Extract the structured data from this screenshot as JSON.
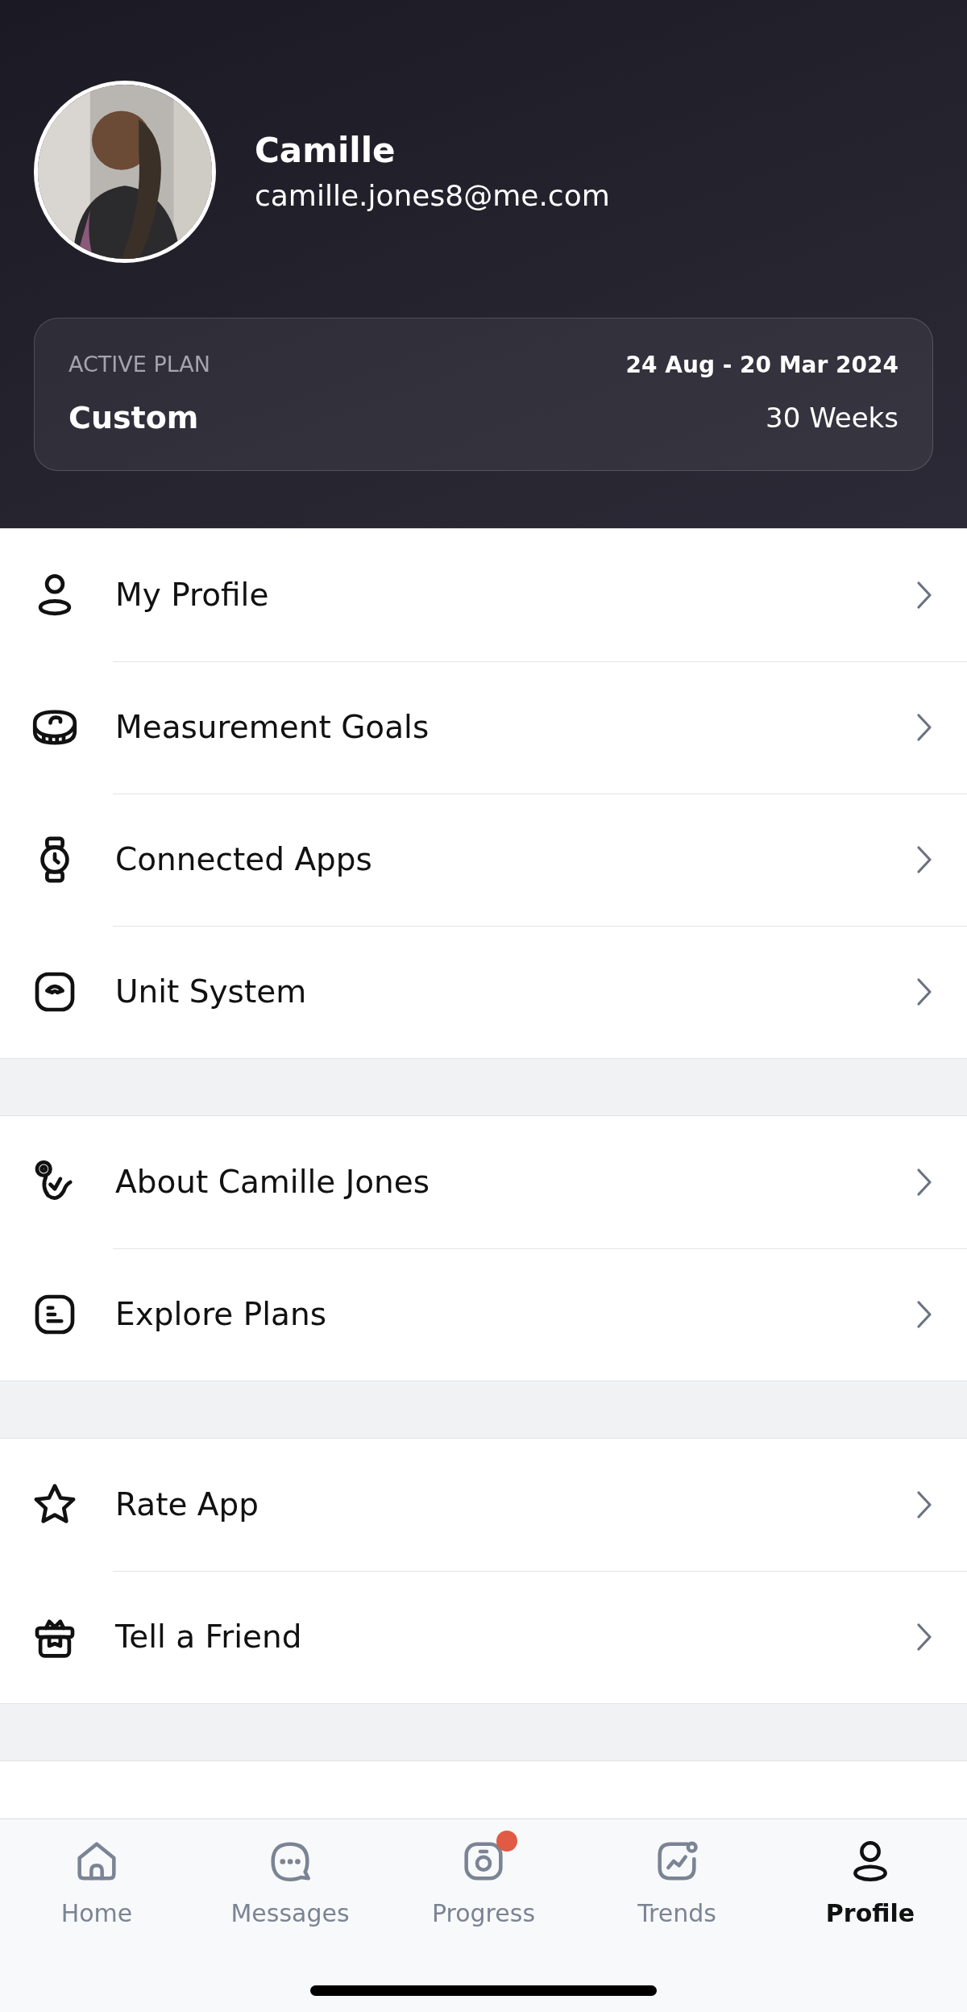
{
  "profile": {
    "name": "Camille",
    "email": "camille.jones8@me.com"
  },
  "plan": {
    "label": "ACTIVE PLAN",
    "name": "Custom",
    "dates": "24 Aug - 20 Mar 2024",
    "duration": "30 Weeks"
  },
  "menu_sections": [
    {
      "items": [
        {
          "label": "My Profile"
        },
        {
          "label": "Measurement Goals"
        },
        {
          "label": "Connected Apps"
        },
        {
          "label": "Unit System"
        }
      ]
    },
    {
      "items": [
        {
          "label": "About Camille Jones"
        },
        {
          "label": "Explore Plans"
        }
      ]
    },
    {
      "items": [
        {
          "label": "Rate App"
        },
        {
          "label": "Tell a Friend"
        }
      ]
    }
  ],
  "tab_bar": [
    {
      "label": "Home",
      "selected": false,
      "notification": false
    },
    {
      "label": "Messages",
      "selected": false,
      "notification": false
    },
    {
      "label": "Progress",
      "selected": false,
      "notification": true
    },
    {
      "label": "Trends",
      "selected": false,
      "notification": false
    },
    {
      "label": "Profile",
      "selected": true,
      "notification": false
    }
  ]
}
